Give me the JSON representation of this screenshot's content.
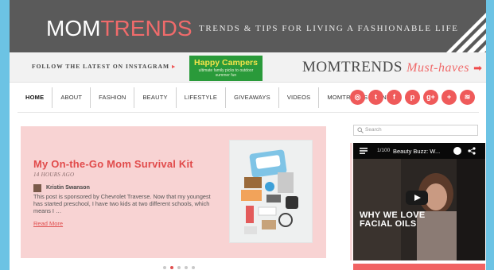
{
  "header": {
    "logo_mom": "MOM",
    "logo_trends": "TRENDS",
    "tagline": "TRENDS & TIPS FOR LIVING A FASHIONABLE LIFE"
  },
  "promo": {
    "instagram": "FOLLOW THE LATEST ON INSTAGRAM",
    "instagram_arrow": "▸",
    "happy_title": "Happy Campers",
    "happy_sub": "ultimate family picks to outdoor summer fun",
    "musthaves_brand": "MOMTRENDS",
    "musthaves_script": "Must-haves",
    "musthaves_arrow": "➡"
  },
  "nav": {
    "items": [
      "HOME",
      "ABOUT",
      "FASHION",
      "BEAUTY",
      "LIFESTYLE",
      "GIVEAWAYS",
      "VIDEOS",
      "MOMTRENDS EVENTS"
    ]
  },
  "social": {
    "icons": [
      "instagram-icon",
      "twitter-icon",
      "facebook-icon",
      "pinterest-icon",
      "googleplus-icon",
      "plus-icon",
      "rss-icon"
    ],
    "glyphs": [
      "◎",
      "t",
      "f",
      "p",
      "g+",
      "+",
      "≋"
    ]
  },
  "hero": {
    "title": "My On-the-Go Mom Survival Kit",
    "time": "14 HOURS AGO",
    "author": "Kristin Swanson",
    "excerpt": "This post is sponsored by Chevrolet Traverse. Now that my youngest has started preschool, I have two kids at two different schools, which means I …",
    "read_more": "Read More"
  },
  "slider": {
    "active_index": 1,
    "count": 5
  },
  "sidebar": {
    "search_placeholder": "Search",
    "video_count": "1/100",
    "video_title": "Beauty Buzz: W...",
    "video_caption": "WHY WE LOVE FACIAL OILS"
  },
  "colors": {
    "accent": "#ef5a5a",
    "header_bg": "#5a5a5a",
    "hero_bg": "#f8d3d3",
    "page_bg": "#6cc3e4"
  }
}
